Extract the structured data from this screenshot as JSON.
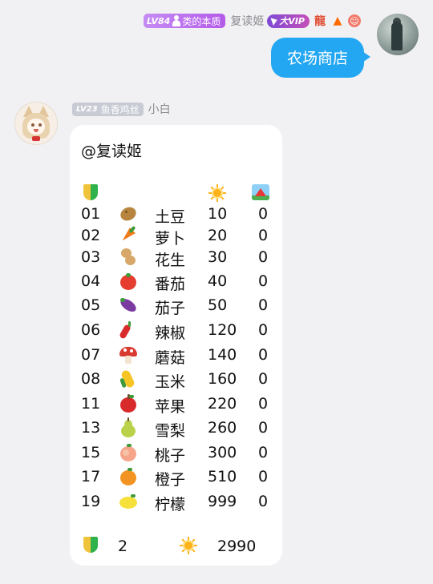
{
  "outgoing": {
    "level_badge": {
      "level": "LV84",
      "title": "类的本质"
    },
    "sender_name": "复读姬",
    "vip_label": "大VIP",
    "message": "农场商店"
  },
  "incoming": {
    "level_badge": {
      "level": "LV23",
      "title": "鱼香鸡丝"
    },
    "sender_name": "小白",
    "mention": "@复读姬",
    "header_icons": [
      "beginner-icon",
      "sun-icon",
      "camping-icon"
    ],
    "rows": [
      {
        "num": "01",
        "icon": "potato-icon",
        "name": "土豆",
        "price": "10",
        "count": "0"
      },
      {
        "num": "02",
        "icon": "carrot-icon",
        "name": "萝卜",
        "price": "20",
        "count": "0"
      },
      {
        "num": "03",
        "icon": "peanut-icon",
        "name": "花生",
        "price": "30",
        "count": "0"
      },
      {
        "num": "04",
        "icon": "tomato-icon",
        "name": "番茄",
        "price": "40",
        "count": "0"
      },
      {
        "num": "05",
        "icon": "eggplant-icon",
        "name": "茄子",
        "price": "50",
        "count": "0"
      },
      {
        "num": "06",
        "icon": "chili-icon",
        "name": "辣椒",
        "price": "120",
        "count": "0"
      },
      {
        "num": "07",
        "icon": "mushroom-icon",
        "name": "蘑菇",
        "price": "140",
        "count": "0"
      },
      {
        "num": "08",
        "icon": "corn-icon",
        "name": "玉米",
        "price": "160",
        "count": "0"
      },
      {
        "num": "11",
        "icon": "apple-icon",
        "name": "苹果",
        "price": "220",
        "count": "0"
      },
      {
        "num": "13",
        "icon": "pear-icon",
        "name": "雪梨",
        "price": "260",
        "count": "0"
      },
      {
        "num": "15",
        "icon": "peach-icon",
        "name": "桃子",
        "price": "300",
        "count": "0"
      },
      {
        "num": "17",
        "icon": "orange-icon",
        "name": "橙子",
        "price": "510",
        "count": "0"
      },
      {
        "num": "19",
        "icon": "lemon-icon",
        "name": "柠檬",
        "price": "999",
        "count": "0"
      }
    ],
    "footer": {
      "level_value": "2",
      "sun_value": "2990"
    }
  },
  "colors": {
    "bubble_out": "#23a7f2",
    "bubble_in": "#ffffff",
    "background": "#f1f1f3",
    "name_gray": "#8a8a8f"
  }
}
